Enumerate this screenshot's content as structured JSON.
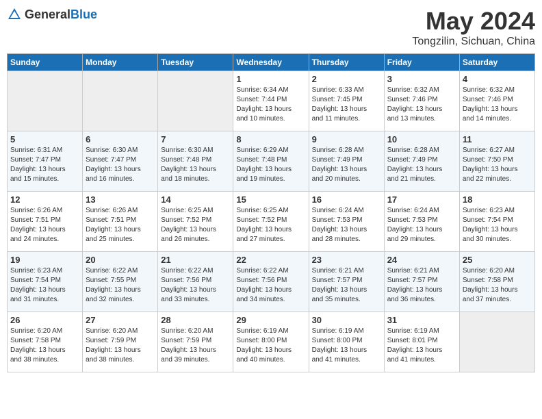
{
  "header": {
    "logo_general": "General",
    "logo_blue": "Blue",
    "month_title": "May 2024",
    "location": "Tongzilin, Sichuan, China"
  },
  "weekdays": [
    "Sunday",
    "Monday",
    "Tuesday",
    "Wednesday",
    "Thursday",
    "Friday",
    "Saturday"
  ],
  "weeks": [
    [
      {
        "day": "",
        "info": ""
      },
      {
        "day": "",
        "info": ""
      },
      {
        "day": "",
        "info": ""
      },
      {
        "day": "1",
        "info": "Sunrise: 6:34 AM\nSunset: 7:44 PM\nDaylight: 13 hours\nand 10 minutes."
      },
      {
        "day": "2",
        "info": "Sunrise: 6:33 AM\nSunset: 7:45 PM\nDaylight: 13 hours\nand 11 minutes."
      },
      {
        "day": "3",
        "info": "Sunrise: 6:32 AM\nSunset: 7:46 PM\nDaylight: 13 hours\nand 13 minutes."
      },
      {
        "day": "4",
        "info": "Sunrise: 6:32 AM\nSunset: 7:46 PM\nDaylight: 13 hours\nand 14 minutes."
      }
    ],
    [
      {
        "day": "5",
        "info": "Sunrise: 6:31 AM\nSunset: 7:47 PM\nDaylight: 13 hours\nand 15 minutes."
      },
      {
        "day": "6",
        "info": "Sunrise: 6:30 AM\nSunset: 7:47 PM\nDaylight: 13 hours\nand 16 minutes."
      },
      {
        "day": "7",
        "info": "Sunrise: 6:30 AM\nSunset: 7:48 PM\nDaylight: 13 hours\nand 18 minutes."
      },
      {
        "day": "8",
        "info": "Sunrise: 6:29 AM\nSunset: 7:48 PM\nDaylight: 13 hours\nand 19 minutes."
      },
      {
        "day": "9",
        "info": "Sunrise: 6:28 AM\nSunset: 7:49 PM\nDaylight: 13 hours\nand 20 minutes."
      },
      {
        "day": "10",
        "info": "Sunrise: 6:28 AM\nSunset: 7:49 PM\nDaylight: 13 hours\nand 21 minutes."
      },
      {
        "day": "11",
        "info": "Sunrise: 6:27 AM\nSunset: 7:50 PM\nDaylight: 13 hours\nand 22 minutes."
      }
    ],
    [
      {
        "day": "12",
        "info": "Sunrise: 6:26 AM\nSunset: 7:51 PM\nDaylight: 13 hours\nand 24 minutes."
      },
      {
        "day": "13",
        "info": "Sunrise: 6:26 AM\nSunset: 7:51 PM\nDaylight: 13 hours\nand 25 minutes."
      },
      {
        "day": "14",
        "info": "Sunrise: 6:25 AM\nSunset: 7:52 PM\nDaylight: 13 hours\nand 26 minutes."
      },
      {
        "day": "15",
        "info": "Sunrise: 6:25 AM\nSunset: 7:52 PM\nDaylight: 13 hours\nand 27 minutes."
      },
      {
        "day": "16",
        "info": "Sunrise: 6:24 AM\nSunset: 7:53 PM\nDaylight: 13 hours\nand 28 minutes."
      },
      {
        "day": "17",
        "info": "Sunrise: 6:24 AM\nSunset: 7:53 PM\nDaylight: 13 hours\nand 29 minutes."
      },
      {
        "day": "18",
        "info": "Sunrise: 6:23 AM\nSunset: 7:54 PM\nDaylight: 13 hours\nand 30 minutes."
      }
    ],
    [
      {
        "day": "19",
        "info": "Sunrise: 6:23 AM\nSunset: 7:54 PM\nDaylight: 13 hours\nand 31 minutes."
      },
      {
        "day": "20",
        "info": "Sunrise: 6:22 AM\nSunset: 7:55 PM\nDaylight: 13 hours\nand 32 minutes."
      },
      {
        "day": "21",
        "info": "Sunrise: 6:22 AM\nSunset: 7:56 PM\nDaylight: 13 hours\nand 33 minutes."
      },
      {
        "day": "22",
        "info": "Sunrise: 6:22 AM\nSunset: 7:56 PM\nDaylight: 13 hours\nand 34 minutes."
      },
      {
        "day": "23",
        "info": "Sunrise: 6:21 AM\nSunset: 7:57 PM\nDaylight: 13 hours\nand 35 minutes."
      },
      {
        "day": "24",
        "info": "Sunrise: 6:21 AM\nSunset: 7:57 PM\nDaylight: 13 hours\nand 36 minutes."
      },
      {
        "day": "25",
        "info": "Sunrise: 6:20 AM\nSunset: 7:58 PM\nDaylight: 13 hours\nand 37 minutes."
      }
    ],
    [
      {
        "day": "26",
        "info": "Sunrise: 6:20 AM\nSunset: 7:58 PM\nDaylight: 13 hours\nand 38 minutes."
      },
      {
        "day": "27",
        "info": "Sunrise: 6:20 AM\nSunset: 7:59 PM\nDaylight: 13 hours\nand 38 minutes."
      },
      {
        "day": "28",
        "info": "Sunrise: 6:20 AM\nSunset: 7:59 PM\nDaylight: 13 hours\nand 39 minutes."
      },
      {
        "day": "29",
        "info": "Sunrise: 6:19 AM\nSunset: 8:00 PM\nDaylight: 13 hours\nand 40 minutes."
      },
      {
        "day": "30",
        "info": "Sunrise: 6:19 AM\nSunset: 8:00 PM\nDaylight: 13 hours\nand 41 minutes."
      },
      {
        "day": "31",
        "info": "Sunrise: 6:19 AM\nSunset: 8:01 PM\nDaylight: 13 hours\nand 41 minutes."
      },
      {
        "day": "",
        "info": ""
      }
    ]
  ]
}
